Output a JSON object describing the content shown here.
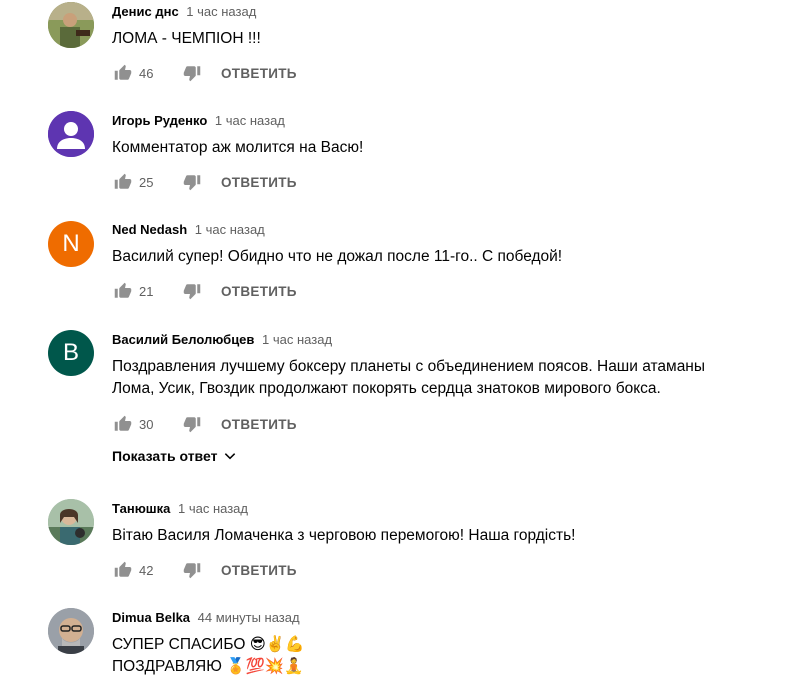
{
  "comments": [
    {
      "author": "Денис днс",
      "time": "1 час назад",
      "text": "ЛОМА - ЧЕМПІОН !!!",
      "likes": "46",
      "reply_label": "ОТВЕТИТЬ",
      "avatar": {
        "type": "photo",
        "colors": [
          "#6b7a3a",
          "#c9b48a",
          "#3e4a2a"
        ]
      }
    },
    {
      "author": "Игорь Руденко",
      "time": "1 час назад",
      "text": "Комментатор аж молится на Васю!",
      "likes": "25",
      "reply_label": "ОТВЕТИТЬ",
      "avatar": {
        "type": "default-person",
        "color": "#5e35b1"
      }
    },
    {
      "author": "Ned Nedash",
      "time": "1 час назад",
      "text": "Василий супер! Обидно что не дожал после 11-го.. С победой!",
      "likes": "21",
      "reply_label": "ОТВЕТИТЬ",
      "avatar": {
        "type": "letter",
        "letter": "N",
        "color": "#ef6c00"
      }
    },
    {
      "author": "Василий Белолюбцев",
      "time": "1 час назад",
      "text": "Поздравления лучшему боксеру планеты с объединением поясов. Наши атаманы\n Лома, Усик, Гвоздик продолжают покорять сердца знатоков мирового бокса.",
      "likes": "30",
      "reply_label": "ОТВЕТИТЬ",
      "show_replies": "Показать ответ",
      "avatar": {
        "type": "letter",
        "letter": "B",
        "color": "#00574b"
      }
    },
    {
      "author": "Танюшка",
      "time": "1 час назад",
      "text": "Вітаю Василя Ломаченка з черговою перемогою! Наша гордість!",
      "likes": "42",
      "reply_label": "ОТВЕТИТЬ",
      "avatar": {
        "type": "photo",
        "colors": [
          "#9bb3a0",
          "#4e7a6a",
          "#2e3b36"
        ]
      }
    },
    {
      "author": "Dimua Belka",
      "time": "44 минуты назад",
      "text": "СУПЕР СПАСИБО 😎✌️💪\nПОЗДРАВЛЯЮ 🏅💯💥🧘",
      "avatar": {
        "type": "photo",
        "colors": [
          "#8a8f98",
          "#c7a98a",
          "#4a4f55"
        ]
      }
    }
  ]
}
